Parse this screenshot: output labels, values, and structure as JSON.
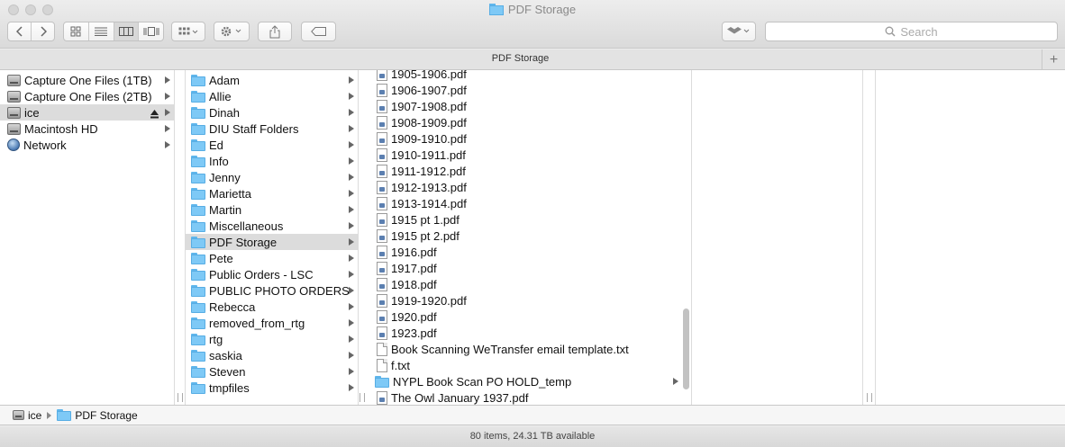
{
  "window": {
    "title": "PDF Storage"
  },
  "toolbar": {
    "search_placeholder": "Search"
  },
  "tabbar": {
    "title": "PDF Storage",
    "add_label": "+"
  },
  "sidebar": {
    "items": [
      {
        "label": "Capture One Files (1TB)",
        "icon": "external-disk-icon"
      },
      {
        "label": "Capture One Files (2TB)",
        "icon": "external-disk-icon"
      },
      {
        "label": "ice",
        "icon": "network-disk-icon",
        "selected": true,
        "eject": true
      },
      {
        "label": "Macintosh HD",
        "icon": "internal-disk-icon"
      },
      {
        "label": "Network",
        "icon": "globe-icon"
      }
    ]
  },
  "folders": {
    "items": [
      "Adam",
      "Allie",
      "Dinah",
      "DIU Staff Folders",
      "Ed",
      "Info",
      "Jenny",
      "Marietta",
      "Martin",
      "Miscellaneous",
      "PDF Storage",
      "Pete",
      "Public Orders - LSC",
      "PUBLIC PHOTO ORDERS",
      "Rebecca",
      "removed_from_rtg",
      "rtg",
      "saskia",
      "Steven",
      "tmpfiles"
    ],
    "selected": "PDF Storage"
  },
  "files": {
    "items": [
      {
        "label": "1905-1906.pdf",
        "type": "pdf"
      },
      {
        "label": "1906-1907.pdf",
        "type": "pdf"
      },
      {
        "label": "1907-1908.pdf",
        "type": "pdf"
      },
      {
        "label": "1908-1909.pdf",
        "type": "pdf"
      },
      {
        "label": "1909-1910.pdf",
        "type": "pdf"
      },
      {
        "label": "1910-1911.pdf",
        "type": "pdf"
      },
      {
        "label": "1911-1912.pdf",
        "type": "pdf"
      },
      {
        "label": "1912-1913.pdf",
        "type": "pdf"
      },
      {
        "label": "1913-1914.pdf",
        "type": "pdf"
      },
      {
        "label": "1915 pt 1.pdf",
        "type": "pdf"
      },
      {
        "label": "1915 pt 2.pdf",
        "type": "pdf"
      },
      {
        "label": "1916.pdf",
        "type": "pdf"
      },
      {
        "label": "1917.pdf",
        "type": "pdf"
      },
      {
        "label": "1918.pdf",
        "type": "pdf"
      },
      {
        "label": "1919-1920.pdf",
        "type": "pdf"
      },
      {
        "label": "1920.pdf",
        "type": "pdf"
      },
      {
        "label": "1923.pdf",
        "type": "pdf"
      },
      {
        "label": "Book Scanning WeTransfer email template.txt",
        "type": "txt"
      },
      {
        "label": "f.txt",
        "type": "txt"
      },
      {
        "label": "NYPL Book Scan PO HOLD_temp",
        "type": "folder"
      },
      {
        "label": "The Owl January 1937.pdf",
        "type": "pdf"
      }
    ]
  },
  "pathbar": {
    "items": [
      "ice",
      "PDF Storage"
    ]
  },
  "status": {
    "text": "80 items, 24.31 TB available"
  }
}
